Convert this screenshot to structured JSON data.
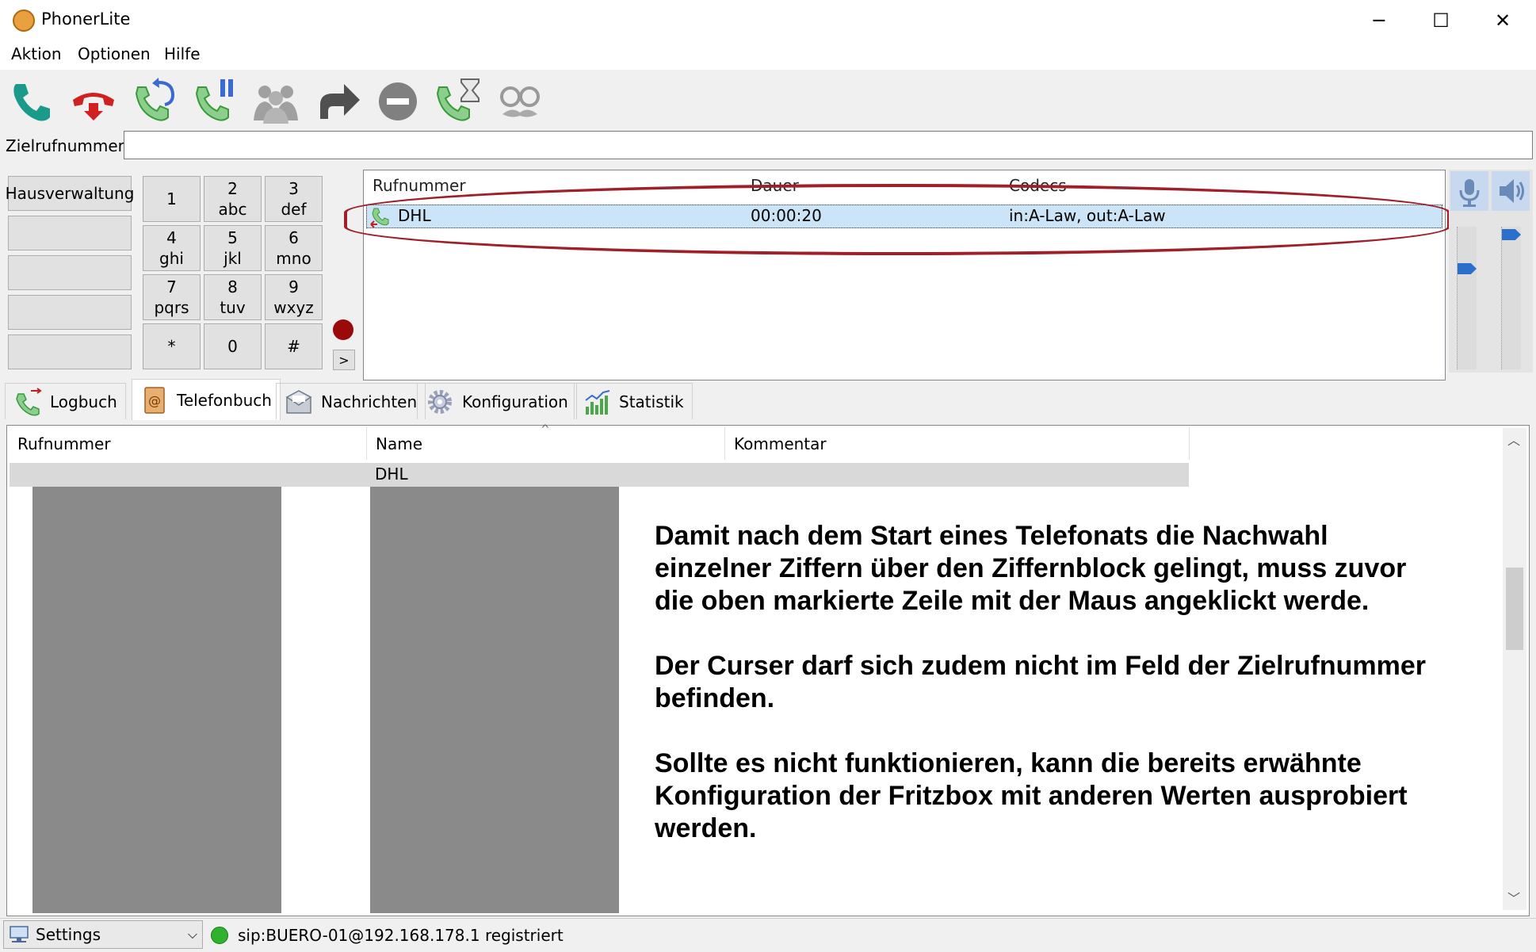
{
  "window": {
    "title": "PhonerLite",
    "minimize": "─",
    "maximize": "☐",
    "close": "✕"
  },
  "menu": [
    "Aktion",
    "Optionen",
    "Hilfe"
  ],
  "toolbar": [
    {
      "name": "call-icon",
      "color": "#1a9a8a"
    },
    {
      "name": "hangup-icon",
      "color": "#d02020"
    },
    {
      "name": "redial-icon",
      "color": "#4aa84a"
    },
    {
      "name": "hold-icon",
      "color": "#4aa84a"
    },
    {
      "name": "conference-icon",
      "color": "#9a9a9a"
    },
    {
      "name": "forward-icon",
      "color": "#555555"
    },
    {
      "name": "do-not-disturb-icon",
      "color": "#777777"
    },
    {
      "name": "call-waiting-icon",
      "color": "#4aa84a"
    },
    {
      "name": "anonymous-icon",
      "color": "#999999"
    }
  ],
  "target": {
    "label": "Zielrufnummer",
    "value": ""
  },
  "speed_dial": [
    "Hausverwaltung",
    "",
    "",
    "",
    ""
  ],
  "keypad": [
    {
      "digit": "1",
      "letters": ""
    },
    {
      "digit": "2",
      "letters": "abc"
    },
    {
      "digit": "3",
      "letters": "def"
    },
    {
      "digit": "4",
      "letters": "ghi"
    },
    {
      "digit": "5",
      "letters": "jkl"
    },
    {
      "digit": "6",
      "letters": "mno"
    },
    {
      "digit": "7",
      "letters": "pqrs"
    },
    {
      "digit": "8",
      "letters": "tuv"
    },
    {
      "digit": "9",
      "letters": "wxyz"
    },
    {
      "digit": "*",
      "letters": ""
    },
    {
      "digit": "0",
      "letters": ""
    },
    {
      "digit": "#",
      "letters": ""
    }
  ],
  "more_button": ">",
  "calls": {
    "headers": [
      "Rufnummer",
      "Dauer",
      "Codecs"
    ],
    "rows": [
      {
        "number": "DHL",
        "duration": "00:00:20",
        "codecs": "in:A-Law, out:A-Law"
      }
    ]
  },
  "volume": {
    "mic_level": 0.72,
    "speaker_level": 0.98
  },
  "tabs": [
    {
      "label": "Logbuch",
      "icon": "logbook-icon",
      "active": false
    },
    {
      "label": "Telefonbuch",
      "icon": "phonebook-icon",
      "active": true
    },
    {
      "label": "Nachrichten",
      "icon": "messages-icon",
      "active": false
    },
    {
      "label": "Konfiguration",
      "icon": "gear-icon",
      "active": false
    },
    {
      "label": "Statistik",
      "icon": "statistics-icon",
      "active": false
    }
  ],
  "phonebook": {
    "headers": [
      "Rufnummer",
      "Name",
      "Kommentar"
    ],
    "sort_indicator": "^",
    "rows": [
      {
        "number": "",
        "name": "DHL",
        "comment": ""
      }
    ]
  },
  "note": [
    "Damit nach dem Start eines Telefonats die Nachwahl einzelner Ziffern über den Ziffernblock gelingt, muss zuvor die oben markierte Zeile mit der Maus angeklickt werde.",
    "Der Curser darf sich zudem nicht im Feld der Zielrufnummer befinden.",
    "Sollte es nicht funktionieren, kann die bereits erwähnte Konfiguration der Fritzbox mit anderen Werten ausprobiert werden."
  ],
  "status": {
    "profile": "Settings",
    "registration": "sip:BUERO-01@192.168.178.1 registriert",
    "indicator_color": "#2fb32f"
  }
}
